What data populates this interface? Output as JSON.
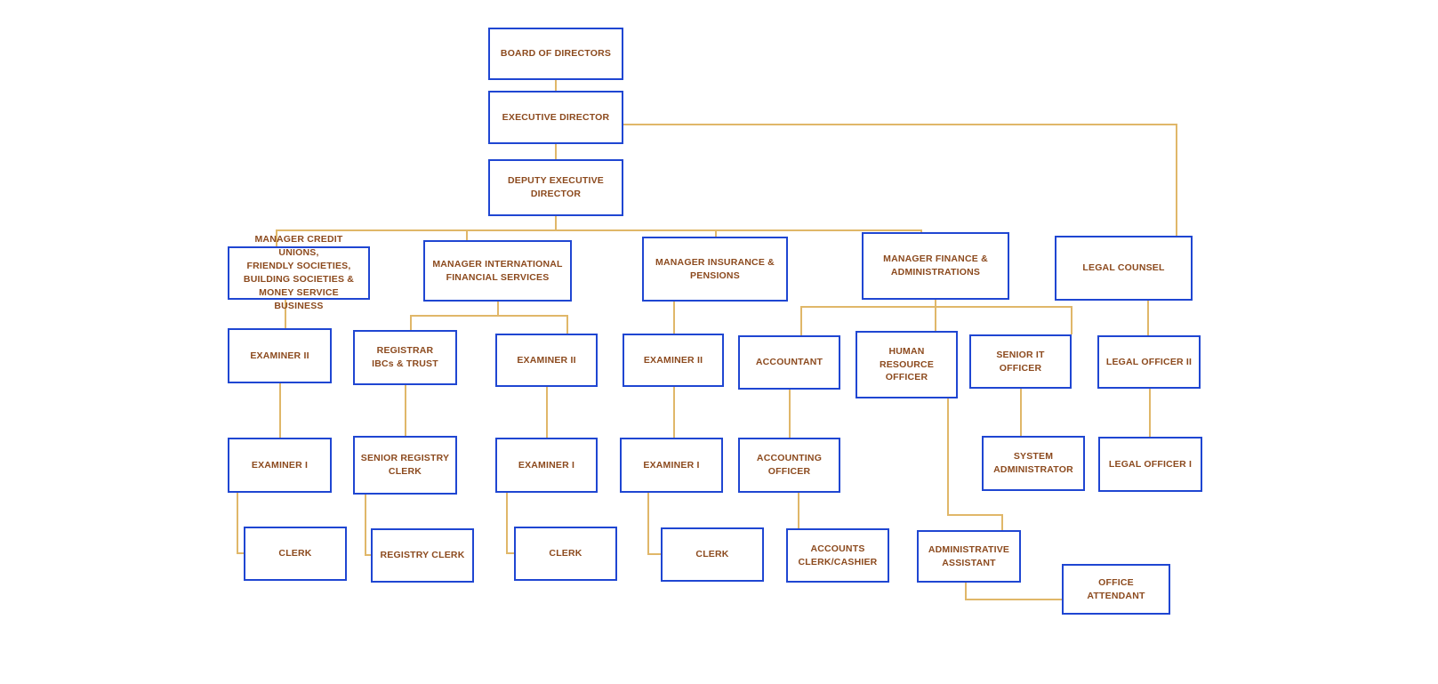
{
  "chart": {
    "type": "org-chart",
    "title": "Organizational Structure Chart",
    "colors": {
      "box_border": "#1f46d2",
      "box_fill": "#ffffff",
      "text": "#8c4a1e",
      "connector": "#e0b769",
      "background": "#ffffff"
    },
    "levels": [
      "Board",
      "Executive",
      "Deputy Executive",
      "Managers",
      "Officers / Senior Staff",
      "Junior Officers",
      "Clerks / Support"
    ]
  },
  "nodes": {
    "board_of_directors": {
      "label": "BOARD OF DIRECTORS"
    },
    "executive_director": {
      "label": "EXECUTIVE DIRECTOR"
    },
    "deputy_executive_director": {
      "label": "DEPUTY EXECUTIVE\nDIRECTOR"
    },
    "manager_credit_unions": {
      "label": "MANAGER CREDIT UNIONS,\nFRIENDLY SOCIETIES,\nBUILDING SOCIETIES &\nMONEY SERVICE BUSINESS"
    },
    "manager_international_financial_services": {
      "label": "MANAGER INTERNATIONAL\nFINANCIAL SERVICES"
    },
    "manager_insurance_pensions": {
      "label": "MANAGER INSURANCE &\nPENSIONS"
    },
    "manager_finance_administrations": {
      "label": "MANAGER FINANCE &\nADMINISTRATIONS"
    },
    "legal_counsel": {
      "label": "LEGAL COUNSEL"
    },
    "examiner_ii_credit_unions": {
      "label": "EXAMINER II"
    },
    "registrar_ibcs_trust": {
      "label": "REGISTRAR\nIBCs & TRUST"
    },
    "examiner_ii_ifs": {
      "label": "EXAMINER II"
    },
    "examiner_ii_insurance": {
      "label": "EXAMINER II"
    },
    "accountant": {
      "label": "ACCOUNTANT"
    },
    "human_resource_officer": {
      "label": "HUMAN RESOURCE\nOFFICER"
    },
    "senior_it_officer": {
      "label": "SENIOR IT OFFICER"
    },
    "legal_officer_ii": {
      "label": "LEGAL OFFICER II"
    },
    "examiner_i_credit_unions": {
      "label": "EXAMINER I"
    },
    "senior_registry_clerk": {
      "label": "SENIOR REGISTRY\nCLERK"
    },
    "examiner_i_ifs": {
      "label": "EXAMINER I"
    },
    "examiner_i_insurance": {
      "label": "EXAMINER I"
    },
    "accounting_officer": {
      "label": "ACCOUNTING OFFICER"
    },
    "system_administrator": {
      "label": "SYSTEM\nADMINISTRATOR"
    },
    "legal_officer_i": {
      "label": "LEGAL OFFICER I"
    },
    "clerk_credit_unions": {
      "label": "CLERK"
    },
    "registry_clerk": {
      "label": "REGISTRY CLERK"
    },
    "clerk_ifs": {
      "label": "CLERK"
    },
    "clerk_insurance": {
      "label": "CLERK"
    },
    "accounts_clerk_cashier": {
      "label": "ACCOUNTS\nCLERK/CASHIER"
    },
    "administrative_assistant": {
      "label": "ADMINISTRATIVE\nASSISTANT"
    },
    "office_attendant": {
      "label": "OFFICE ATTENDANT"
    }
  }
}
